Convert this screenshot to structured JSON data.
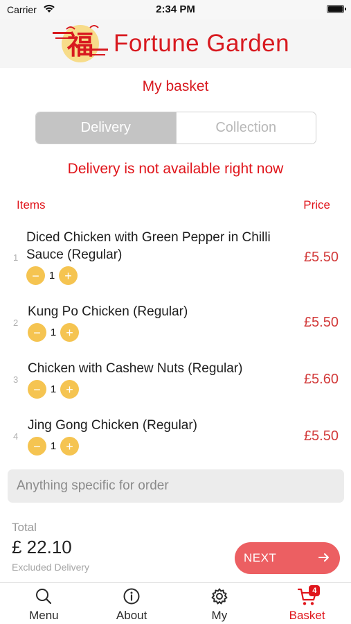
{
  "status_bar": {
    "carrier": "Carrier",
    "time": "2:34 PM"
  },
  "header": {
    "brand_name": "Fortune Garden",
    "logo_glyph": "福"
  },
  "page_title": "My basket",
  "order_type": {
    "options": [
      "Delivery",
      "Collection"
    ],
    "selected": "Delivery"
  },
  "notice": "Delivery is not available right now",
  "columns": {
    "items": "Items",
    "price": "Price"
  },
  "items": [
    {
      "index": "1",
      "name": "Diced Chicken with Green Pepper in Chilli Sauce (Regular)",
      "qty": "1",
      "price": "£5.50"
    },
    {
      "index": "2",
      "name": "Kung Po Chicken (Regular)",
      "qty": "1",
      "price": "£5.50"
    },
    {
      "index": "3",
      "name": "Chicken with Cashew Nuts (Regular)",
      "qty": "1",
      "price": "£5.60"
    },
    {
      "index": "4",
      "name": "Jing Gong Chicken (Regular)",
      "qty": "1",
      "price": "£5.50"
    }
  ],
  "qty_controls": {
    "minus": "−",
    "plus": "+"
  },
  "order_note": {
    "placeholder": "Anything specific for order",
    "value": ""
  },
  "total": {
    "label": "Total",
    "amount": "£ 22.10",
    "note": "Excluded Delivery"
  },
  "next_button": {
    "label": "NEXT"
  },
  "tabbar": {
    "tabs": [
      {
        "label": "Menu",
        "icon": "search-icon"
      },
      {
        "label": "About",
        "icon": "info-icon"
      },
      {
        "label": "My",
        "icon": "gear-icon"
      },
      {
        "label": "Basket",
        "icon": "cart-icon",
        "badge": "4",
        "active": true
      }
    ]
  },
  "colors": {
    "brand_red": "#d8191f",
    "qty_yellow": "#f5c451",
    "next_button": "#ec5f62"
  }
}
